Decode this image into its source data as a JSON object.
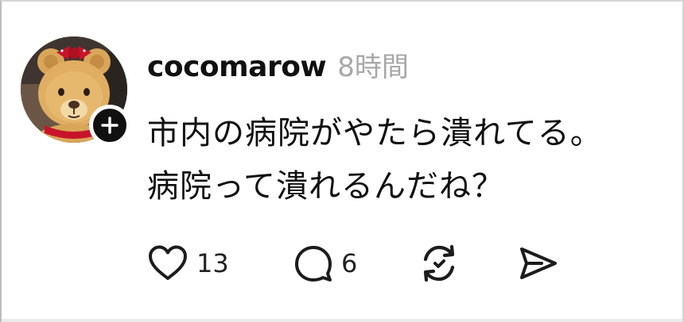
{
  "post": {
    "username": "cocomarow",
    "timestamp": "8時間",
    "lines": [
      "市内の病院がやたら潰れてる。",
      "病院って潰れるんだね？"
    ]
  },
  "avatar": {
    "icon": "teddy-bear-avatar",
    "follow_icon": "plus-icon"
  },
  "actions": {
    "like": {
      "icon": "heart-icon",
      "count": "13"
    },
    "reply": {
      "icon": "comment-bubble-icon",
      "count": "6"
    },
    "repost": {
      "icon": "repost-icon"
    },
    "share": {
      "icon": "send-icon"
    }
  },
  "colors": {
    "text": "#101010",
    "muted": "#a8a8a8",
    "badge": "#101010",
    "icon": "#1c1c1c"
  }
}
